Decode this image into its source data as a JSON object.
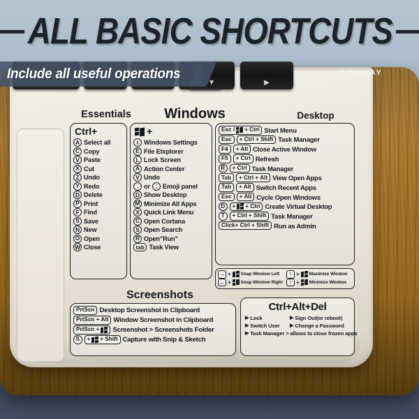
{
  "headline": "ALL BASIC SHORTCUTS",
  "banner": "Include all useful operations",
  "brand": "CITHWAY",
  "keyboard": {
    "down_key": "▼",
    "play_key": "▶"
  },
  "headers": {
    "essentials": "Essentials",
    "windows": "Windows",
    "desktop": "Desktop",
    "screenshots": "Screenshots"
  },
  "essentials": {
    "title": "Ctrl+",
    "items": [
      {
        "key": "A",
        "label": "Select all"
      },
      {
        "key": "C",
        "label": "Copy"
      },
      {
        "key": "V",
        "label": "Paste"
      },
      {
        "key": "X",
        "label": "Cut"
      },
      {
        "key": "Z",
        "label": "Undo"
      },
      {
        "key": "Y",
        "label": "Redo"
      },
      {
        "key": "D",
        "label": "Delete"
      },
      {
        "key": "P",
        "label": "Print"
      },
      {
        "key": "F",
        "label": "Find"
      },
      {
        "key": "S",
        "label": "Save"
      },
      {
        "key": "N",
        "label": "New"
      },
      {
        "key": "O",
        "label": "Open"
      },
      {
        "key": "W",
        "label": "Close"
      }
    ]
  },
  "windows": {
    "title": "+",
    "title_icon": "windows-logo-icon",
    "items": [
      {
        "key": "I",
        "label": "Windows Settings"
      },
      {
        "key": "E",
        "label": "File Etxplorer"
      },
      {
        "key": "L",
        "label": "Lock Screen"
      },
      {
        "key": "A",
        "label": "Action Center"
      },
      {
        "key": "V",
        "label": "Undo"
      },
      {
        "key": ".",
        "alt_sep": "or",
        "key2": ";",
        "label": "Emoji panel"
      },
      {
        "key": "D",
        "label": "Show Desktop"
      },
      {
        "key": "M",
        "label": "Minimize All Apps"
      },
      {
        "key": "X",
        "label": "Quick Link Menu"
      },
      {
        "key": "C",
        "label": "Open Cortana"
      },
      {
        "key": "S",
        "label": "Open Search"
      },
      {
        "key": "R",
        "label": "Open\"Run\""
      },
      {
        "key": "tab",
        "wide": true,
        "label": "Task View"
      }
    ]
  },
  "desktop": {
    "items": [
      {
        "combo": [
          "Esc / ⊞ + Ctrl"
        ],
        "single_pill": true,
        "label": "Start Menu"
      },
      {
        "key": "Esc",
        "mod": "+ Ctrl + Shift",
        "label": "Task Manager"
      },
      {
        "key": "F4",
        "mod": "+ Alt",
        "label": "Close Active Window"
      },
      {
        "key": "F5",
        "mod": "+ Ctrl",
        "label": "Refresh"
      },
      {
        "key": "R",
        "round": true,
        "mod": "+ Ctrl",
        "label": "Task Manager"
      },
      {
        "key": "Tab",
        "mod": "+ Ctrl + Alt",
        "label": "View Open Apps"
      },
      {
        "key": "Tab",
        "mod": "+ Alt",
        "label": "Switch Recent Apps"
      },
      {
        "key": "Esc",
        "mod": "+ Alt",
        "label": "Cycle Open Windows"
      },
      {
        "key": "D",
        "round": true,
        "mod_win": true,
        "mod": "+ Ctrl",
        "label": "Create Virtual Desktop"
      },
      {
        "key": "T",
        "round": true,
        "mod": "+ Ctrl + Shift",
        "label": "Task Manager"
      },
      {
        "combo": [
          "Click+ Ctrl + Shift"
        ],
        "single_pill": true,
        "label": "Run as Admin"
      }
    ]
  },
  "snap": {
    "items": [
      {
        "arrow": "→",
        "label": "Snap Window Left"
      },
      {
        "arrow": "↑",
        "label": "Maximize Window"
      },
      {
        "arrow": "←",
        "label": "Snap Window Right"
      },
      {
        "arrow": "↑",
        "label": "Minimize Window"
      }
    ]
  },
  "screenshots": {
    "items": [
      {
        "keys": [
          "PrtScn"
        ],
        "label": "Desktop Screenshot in Clipboard"
      },
      {
        "keys": [
          "PrtScn + Alt"
        ],
        "label": "Window Screenshot in Clipboard"
      },
      {
        "keys": [
          "PrtScn + ⊞"
        ],
        "win_in_key": true,
        "label": "Screenshot > Screenshots Folder"
      },
      {
        "keys": [
          "S",
          "+ ⊞ + Shift"
        ],
        "first_round": true,
        "win_in_second": true,
        "label": "Capture with Snip & Sketch"
      }
    ]
  },
  "ctrl_alt_del": {
    "title": "Ctrl+Alt+Del",
    "items": [
      "Lock",
      "Sign Out(or reboot)",
      "Switch User",
      "Change a Password"
    ],
    "full_item": "Task Manager > allows to close frozen apps"
  }
}
